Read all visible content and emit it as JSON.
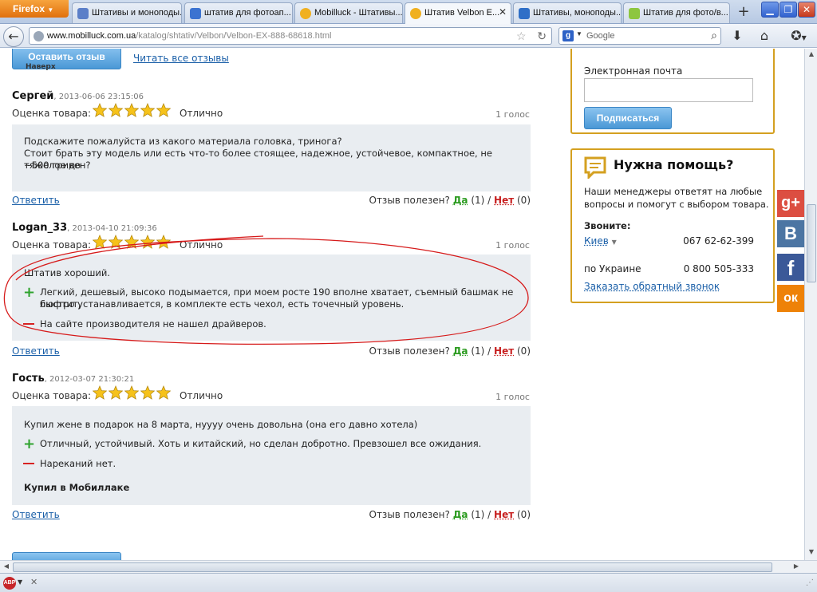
{
  "browser": {
    "app_button": "Firefox",
    "tabs": [
      {
        "title": "Штативы и моноподы...",
        "icon_color": "#5b7fc8",
        "active": false
      },
      {
        "title": "штатив для фотоап...",
        "icon_color": "#3b73d1",
        "active": false
      },
      {
        "title": "Mobilluck - Штативы...",
        "icon_color": "#f0b020",
        "active": false
      },
      {
        "title": "Штатив Velbon E...",
        "icon_color": "#f0b020",
        "active": true
      },
      {
        "title": "Штативы, моноподы...",
        "icon_color": "#2f6fc7",
        "active": false
      },
      {
        "title": "Штатив для фото/в...",
        "icon_color": "#8dc63f",
        "active": false
      }
    ],
    "new_tab": "+",
    "url_domain": "www.mobilluck.com.ua",
    "url_path": "/katalog/shtativ/Velbon/Velbon-EX-888-68618.html",
    "search_placeholder": "Google",
    "search_engine_icon": "google-icon"
  },
  "reviews_header": {
    "leave_review": "Оставить отзыв",
    "back_top": "Наверх",
    "read_all": "Читать все отзывы"
  },
  "reviews": [
    {
      "name": "Сергей",
      "date": "2013-06-06 23:15:06",
      "rating_label": "Оценка товара:",
      "stars": 5,
      "rating_word": "Отлично",
      "votes": "1 голос",
      "text_lines": [
        "Подскажите пожалуйста из какого материала головка, тринога?",
        "Стоит брать эту модель или есть что-то более стоящее, надежное, устойчевое, компактное, не тяжелое до",
        "~500 гривен?"
      ],
      "reply": "Ответить",
      "useful_label": "Отзыв полезен?",
      "yes": "Да",
      "yes_count": "(1)",
      "no": "Нет",
      "no_count": "(0)"
    },
    {
      "name": "Logan_33",
      "date": "2013-04-10 21:09:36",
      "rating_label": "Оценка товара:",
      "stars": 5,
      "rating_word": "Отлично",
      "votes": "1 голос",
      "summary": "Штатив хороший.",
      "pros": [
        "Легкий, дешевый, высоко подымается, при моем росте 190 вполне хватает, съемный башмак не люфтит,",
        "быстро устанавливается, в комплекте есть чехол, есть точечный уровень."
      ],
      "cons": "На сайте производителя не нашел драйверов.",
      "reply": "Ответить",
      "useful_label": "Отзыв полезен?",
      "yes": "Да",
      "yes_count": "(1)",
      "no": "Нет",
      "no_count": "(0)"
    },
    {
      "name": "Гость",
      "date": "2012-03-07 21:30:21",
      "rating_label": "Оценка товара:",
      "stars": 5,
      "rating_word": "Отлично",
      "votes": "1 голос",
      "summary": "Купил жене в подарок на 8 марта, нуууу очень довольна (она его давно хотела)",
      "pros": [
        "Отличный, устойчивый. Хоть и китайский, но сделан добротно. Превзошел все ожидания."
      ],
      "cons": "Нареканий нет.",
      "bought": "Купил в Мобиллаке",
      "reply": "Ответить",
      "useful_label": "Отзыв полезен?",
      "yes": "Да",
      "yes_count": "(1)",
      "no": "Нет",
      "no_count": "(0)"
    }
  ],
  "subscribe": {
    "email_label": "Электронная почта",
    "email_value": "",
    "button": "Подписаться"
  },
  "help": {
    "title": "Нужна помощь?",
    "description_lines": [
      "Наши менеджеры ответят на любые",
      "вопросы и помогут с выбором товара."
    ],
    "call_label": "Звоните:",
    "city": "Киев",
    "city_phone": "067 62-62-399",
    "ukraine_label": "по Украине",
    "ukraine_phone": "0 800 505-333",
    "callback": "Заказать обратный звонок"
  },
  "social": [
    {
      "name": "google-plus",
      "glyph": "g+",
      "color": "#dc4e41"
    },
    {
      "name": "vkontakte",
      "glyph": "В",
      "color": "#4c75a3"
    },
    {
      "name": "facebook",
      "glyph": "f",
      "color": "#3b5998"
    },
    {
      "name": "odnoklassniki",
      "glyph": "ок",
      "color": "#ee8208"
    }
  ],
  "colors": {
    "accent_blue": "#4a98d6",
    "link": "#1a5fa8",
    "box_border": "#d4a020",
    "yes_green": "#2b9b1f",
    "no_red": "#c71f1f",
    "annotation_red": "#d61a1a"
  }
}
